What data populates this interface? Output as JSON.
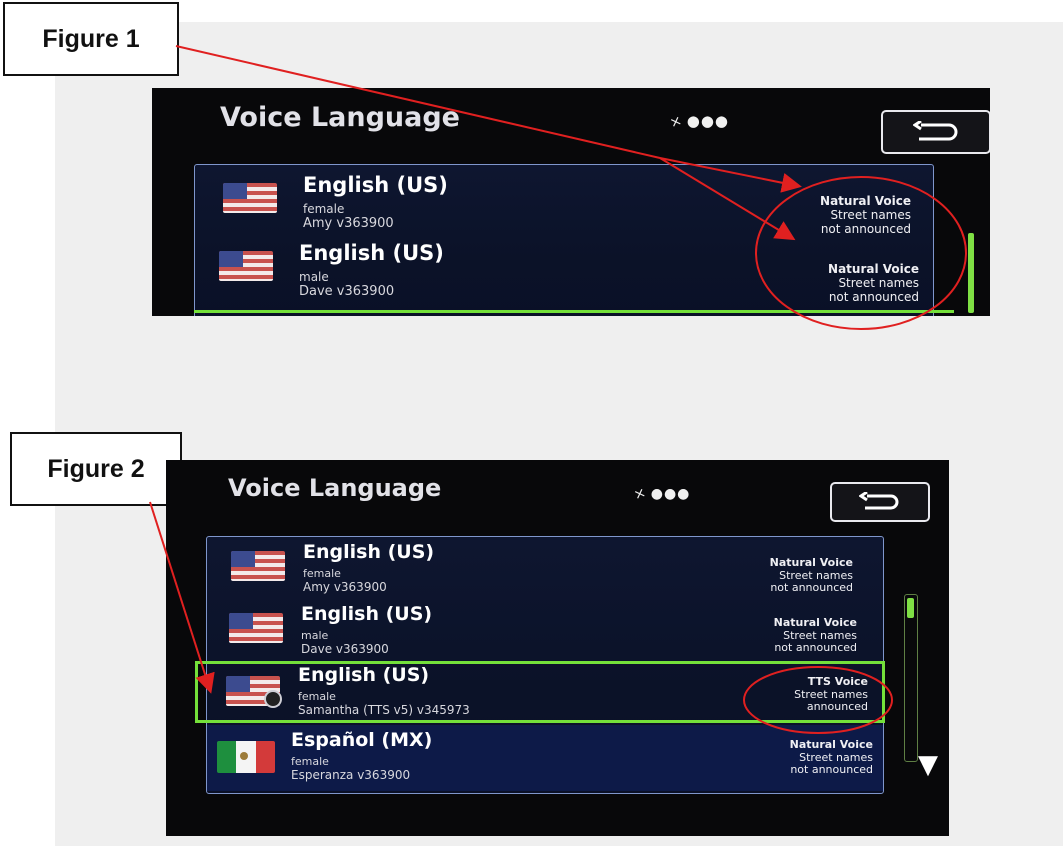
{
  "figure1": {
    "label": "Figure 1",
    "screen": {
      "title": "Voice Language",
      "rows": [
        {
          "language": "English (US)",
          "gender": "female",
          "voice": "Amy v363900",
          "voice_type": "Natural Voice",
          "street_1": "Street names",
          "street_2": "not announced"
        },
        {
          "language": "English (US)",
          "gender": "male",
          "voice": "Dave v363900",
          "voice_type": "Natural Voice",
          "street_1": "Street names",
          "street_2": "not announced"
        }
      ]
    }
  },
  "figure2": {
    "label": "Figure 2",
    "screen": {
      "title": "Voice Language",
      "rows": [
        {
          "language": "English (US)",
          "gender": "female",
          "voice": "Amy v363900",
          "voice_type": "Natural Voice",
          "street_1": "Street names",
          "street_2": "not announced"
        },
        {
          "language": "English (US)",
          "gender": "male",
          "voice": "Dave v363900",
          "voice_type": "Natural Voice",
          "street_1": "Street names",
          "street_2": "not announced"
        },
        {
          "language": "English (US)",
          "gender": "female",
          "voice": "Samantha (TTS v5) v345973",
          "voice_type": "TTS Voice",
          "street_1": "Street names",
          "street_2": "announced",
          "selected": true
        },
        {
          "language": "Español (MX)",
          "gender": "female",
          "voice": "Esperanza v363900",
          "voice_type": "Natural Voice",
          "street_1": "Street names",
          "street_2": "not announced"
        }
      ]
    }
  },
  "icons": {
    "status": "satellite-signal-icon",
    "back": "back-arrow-icon",
    "scroll_down": "triangle-down-icon",
    "flag_us": "us-flag-icon",
    "flag_mx": "mexico-flag-icon"
  },
  "colors": {
    "annotation": "#e02020",
    "selection": "#74e03a",
    "list_border": "#7f96cc"
  }
}
